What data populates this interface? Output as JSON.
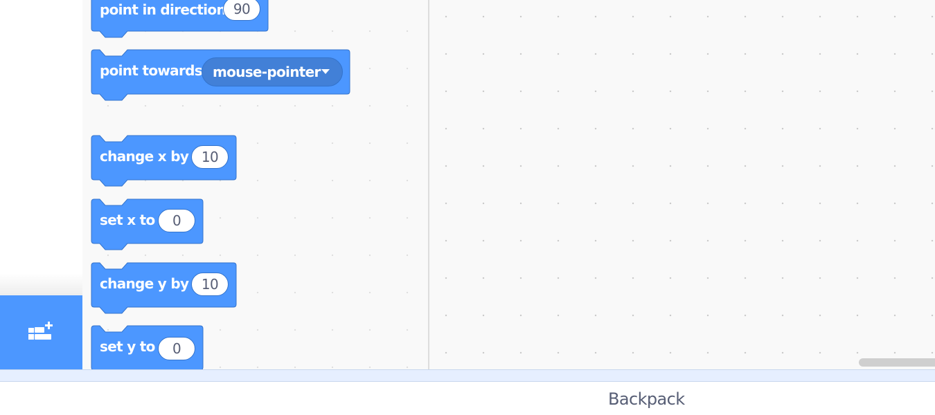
{
  "category_panel": {
    "extension_button": {
      "icon": "add-extension-icon",
      "color": "#4c97ff"
    }
  },
  "palette": {
    "block_color": "#4c97ff",
    "block_border": "#3373cc",
    "blocks": [
      {
        "label": "point in direction",
        "input": "90"
      },
      {
        "label": "point towards",
        "dropdown": "mouse-pointer"
      },
      {
        "label": "change x by",
        "input": "10"
      },
      {
        "label": "set x to",
        "input": "0"
      },
      {
        "label": "change y by",
        "input": "10"
      },
      {
        "label": "set y to",
        "input": "0"
      }
    ]
  },
  "backpack": {
    "label": "Backpack",
    "strip_color": "#e6efff",
    "text_color": "#575e75"
  }
}
